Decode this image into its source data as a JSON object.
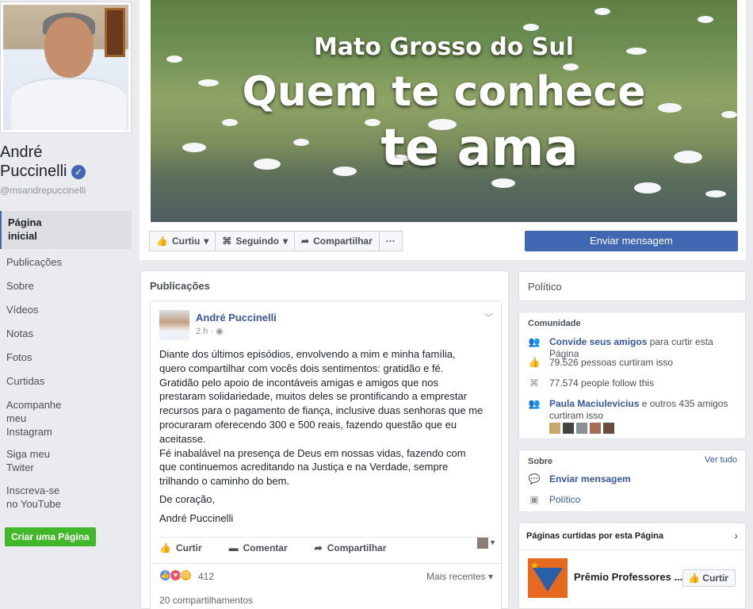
{
  "sidebar": {
    "page_name": "André\nPuccinelli",
    "verified_glyph": "✓",
    "handle": "@msandrepuccinelli",
    "items": [
      {
        "label": "Página\ninicial"
      },
      {
        "label": "Publicações"
      },
      {
        "label": "Sobre"
      },
      {
        "label": "Vídeos"
      },
      {
        "label": "Notas"
      },
      {
        "label": "Fotos"
      },
      {
        "label": "Curtidas"
      },
      {
        "label": "Acompanhe\nmeu\nInstagram"
      },
      {
        "label": "Siga meu\nTwiter"
      },
      {
        "label": "Inscreva-se\nno YouTube"
      }
    ],
    "create_page": "Criar uma Página"
  },
  "cover": {
    "line1": "Mato Grosso do Sul",
    "line2": "Quem te conhece",
    "line3": "te ama"
  },
  "actions": {
    "like": "Curtiu",
    "follow": "Seguindo",
    "share": "Compartilhar",
    "more": "···",
    "send_message": "Enviar mensagem"
  },
  "publicacoes": {
    "title": "Publicações",
    "post": {
      "author": "André Puccinelli",
      "time": "2 h · ",
      "text": "Diante dos últimos episódios, envolvendo a mim e minha família,\nquero compartilhar com vocês dois sentimentos: gratidão e fé.\nGratidão pelo apoio de incontáveis amigas e amigos que nos\nprestaram solidariedade, muitos deles se prontificando a emprestar\nrecursos para o pagamento de fiança, inclusive duas senhoras que me\nprocuraram oferecendo 300 e 500 reais, fazendo questão que eu\naceitasse.\nFé inabalável na presença de Deus em nossas vidas, fazendo com\nque continuemos acreditando na Justiça e na Verdade, sempre\ntrilhando o caminho do bem.",
      "closing": "De coração,",
      "signature": "André Puccinelli",
      "like": "Curtir",
      "comment": "Comentar",
      "share": "Compartilhar",
      "reactions_count": "412",
      "sort": "Mais recentes",
      "shares": "20 compartilhamentos"
    }
  },
  "right": {
    "category": "Político",
    "community": {
      "title": "Comunidade",
      "invite_link": "Convide seus amigos",
      "invite_rest": " para curtir esta Página",
      "likes": "79.526 pessoas curtiram isso",
      "follows": "77.574 people follow this",
      "friends_link": "Paula Maciulevicius",
      "friends_rest": " e outros 435 amigos curtiram isso"
    },
    "about": {
      "title": "Sobre",
      "see_all": "Ver tudo",
      "message": "Enviar mensagem",
      "category": "Político"
    },
    "liked_pages": {
      "title": "Páginas curtidas por esta Página",
      "page_name": "Prêmio Professores ...",
      "like_button": "Curtir"
    }
  },
  "colors": {
    "brand": "#4267b2",
    "link": "#365899",
    "create_button": "#42b72a"
  }
}
